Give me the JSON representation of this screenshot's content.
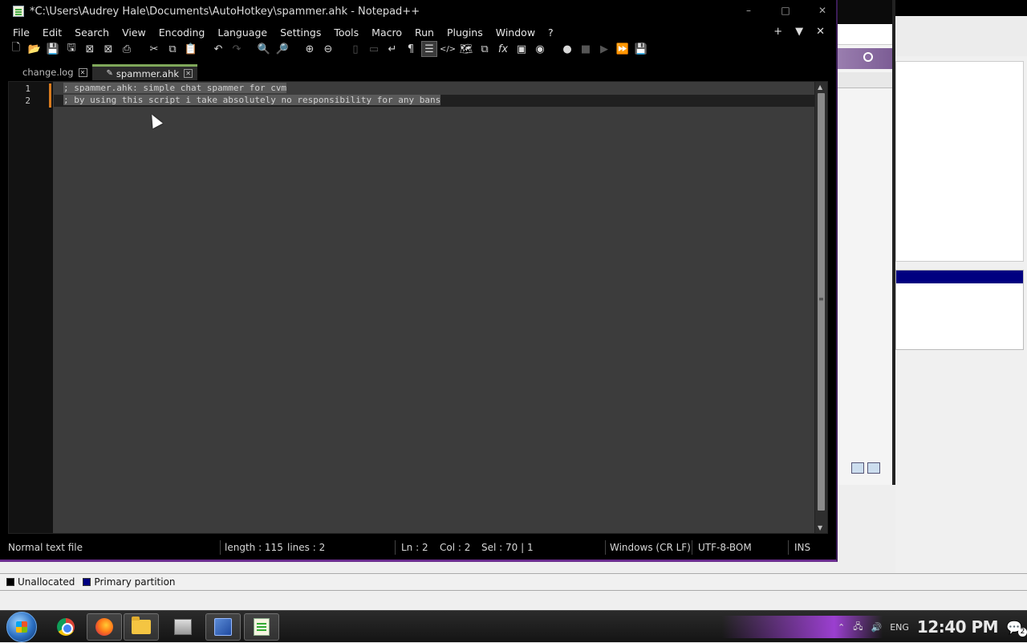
{
  "window": {
    "title": "*C:\\Users\\Audrey Hale\\Documents\\AutoHotkey\\spammer.ahk - Notepad++",
    "controls": {
      "minimize": "–",
      "maximize": "□",
      "close": "✕"
    }
  },
  "menu": {
    "items": [
      "File",
      "Edit",
      "Search",
      "View",
      "Encoding",
      "Language",
      "Settings",
      "Tools",
      "Macro",
      "Run",
      "Plugins",
      "Window",
      "?"
    ],
    "right": {
      "add": "+",
      "dropdown": "▼",
      "close": "✕"
    }
  },
  "toolbar": {
    "buttons": [
      {
        "icon": "new-file-icon",
        "glyph": "🗋"
      },
      {
        "icon": "open-file-icon",
        "glyph": "📂"
      },
      {
        "icon": "save-icon",
        "glyph": "💾"
      },
      {
        "icon": "save-all-icon",
        "glyph": "🖫"
      },
      {
        "icon": "close-file-icon",
        "glyph": "⊠"
      },
      {
        "icon": "close-all-icon",
        "glyph": "⊠"
      },
      {
        "icon": "print-icon",
        "glyph": "⎙"
      },
      {
        "icon": "cut-icon",
        "glyph": "✂"
      },
      {
        "icon": "copy-icon",
        "glyph": "⧉"
      },
      {
        "icon": "paste-icon",
        "glyph": "📋"
      },
      {
        "icon": "undo-icon",
        "glyph": "↶"
      },
      {
        "icon": "redo-icon",
        "glyph": "↷"
      },
      {
        "icon": "find-icon",
        "glyph": "🔍"
      },
      {
        "icon": "replace-icon",
        "glyph": "🔎"
      },
      {
        "icon": "zoom-in-icon",
        "glyph": "⊕"
      },
      {
        "icon": "zoom-out-icon",
        "glyph": "⊖"
      },
      {
        "icon": "sync-vertical-icon",
        "glyph": "▯"
      },
      {
        "icon": "sync-horizontal-icon",
        "glyph": "▭"
      },
      {
        "icon": "word-wrap-icon",
        "glyph": "↵"
      },
      {
        "icon": "show-all-chars-icon",
        "glyph": "¶"
      },
      {
        "icon": "indent-guide-icon",
        "glyph": "☰"
      },
      {
        "icon": "udl-icon",
        "glyph": "</>"
      },
      {
        "icon": "doc-map-icon",
        "glyph": "🗺"
      },
      {
        "icon": "doc-list-icon",
        "glyph": "⧉"
      },
      {
        "icon": "function-list-icon",
        "glyph": "fx"
      },
      {
        "icon": "folder-as-workspace-icon",
        "glyph": "▣"
      },
      {
        "icon": "monitoring-icon",
        "glyph": "◉"
      },
      {
        "icon": "record-macro-icon",
        "glyph": "●"
      },
      {
        "icon": "stop-macro-icon",
        "glyph": "■"
      },
      {
        "icon": "play-macro-icon",
        "glyph": "▶"
      },
      {
        "icon": "run-macro-multiple-icon",
        "glyph": "⏩"
      },
      {
        "icon": "save-macro-icon",
        "glyph": "💾"
      }
    ]
  },
  "tabs": [
    {
      "label": "change.log",
      "active": false,
      "modified": false
    },
    {
      "label": "spammer.ahk",
      "active": true,
      "modified": true
    }
  ],
  "editor": {
    "line_numbers": [
      "1",
      "2"
    ],
    "lines": [
      "; spammer.ahk: simple chat spammer for cvm",
      "; by using this script i take absolutely no responsibility for any bans"
    ]
  },
  "statusbar": {
    "file_type": "Normal text file",
    "length": "length : 115",
    "lines": "lines : 2",
    "ln": "Ln : 2",
    "col": "Col : 2",
    "sel": "Sel : 70 | 1",
    "eol": "Windows (CR LF)",
    "encoding": "UTF-8-BOM",
    "mode": "INS"
  },
  "legend": {
    "items": [
      {
        "label": "Unallocated",
        "color": "#000000"
      },
      {
        "label": "Primary partition",
        "color": "#000080"
      }
    ]
  },
  "taskbar": {
    "apps": [
      "start-orb",
      "chrome-icon",
      "firefox-icon",
      "explorer-icon",
      "generic-app-icon",
      "disk-management-icon",
      "notepadpp-icon"
    ],
    "language": "ENG",
    "clock": "12:40 PM",
    "notifications": "2"
  },
  "colors": {
    "accent_purple": "#6b2d8f",
    "editor_bg": "#3c3c3c",
    "gutter_bg": "#121212",
    "fold_marker": "#d97b1e",
    "active_tab_marker": "#7fa85a"
  }
}
